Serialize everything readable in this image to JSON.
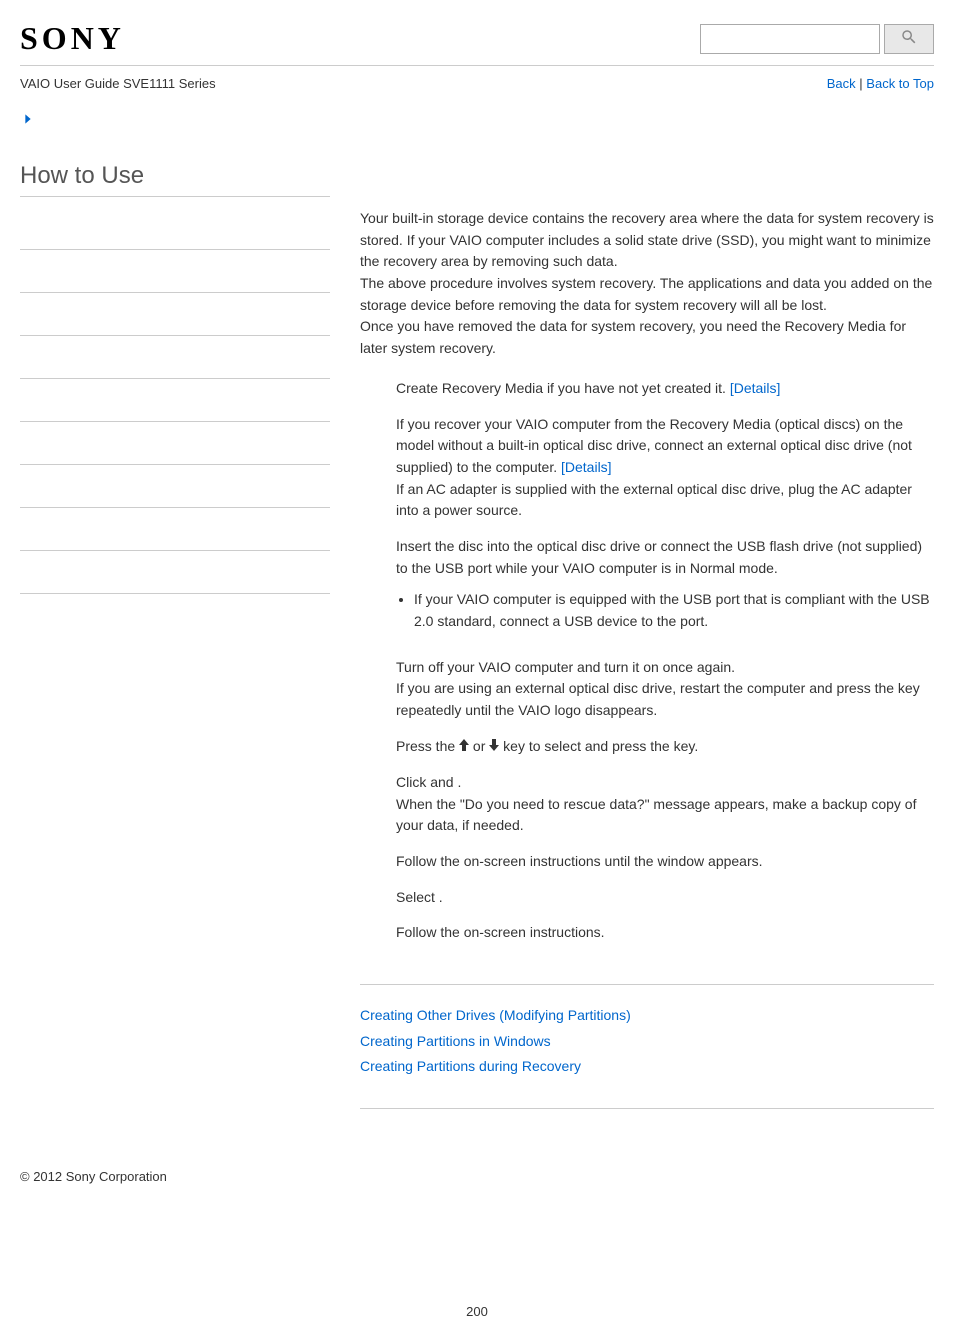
{
  "header": {
    "logo": "SONY",
    "guide_label": "VAIO User Guide SVE1111 Series",
    "back_label": "Back",
    "top_label": "Back to Top"
  },
  "sidebar": {
    "title": "How to Use"
  },
  "content": {
    "intro_p1": "Your built-in storage device contains the recovery area where the data for system recovery is stored. If your VAIO computer includes a solid state drive (SSD), you might want to minimize the recovery area by removing such data.",
    "intro_p2": "The above procedure involves system recovery. The applications and data you added on the storage device before removing the data for system recovery will all be lost.",
    "intro_p3": "Once you have removed the data for system recovery, you need the Recovery Media for later system recovery.",
    "step1_a": "Create Recovery Media if you have not yet created it. ",
    "details_label": "[Details]",
    "step2_a": "If you recover your VAIO computer from the Recovery Media (optical discs) on the model without a built-in optical disc drive, connect an external optical disc drive (not supplied) to the computer. ",
    "step2_b": "If an AC adapter is supplied with the external optical disc drive, plug the AC adapter into a power source.",
    "step3": "Insert the disc into the optical disc drive or connect the USB flash drive (not supplied) to the USB port while your VAIO computer is in Normal mode.",
    "note1": "If your VAIO computer is equipped with the USB port that is compliant with the USB 2.0 standard, connect a USB device to the port.",
    "step4_a": "Turn off your VAIO computer and turn it on once again.",
    "step4_b": "If you are using an external optical disc drive, restart the computer and press the         key repeatedly until the VAIO logo disappears.",
    "step5_a": "Press the ",
    "step5_b": " or ",
    "step5_c": " key to select                                          and press the               key.",
    "step6_a": "Click             and                                                                        .",
    "step6_b": "When the \"Do you need to rescue data?\" message appears, make a backup copy of your data, if needed.",
    "step7": "Follow the on-screen instructions until the                                                 window appears.",
    "step8": "Select                                                                                          .",
    "step9": "Follow the on-screen instructions.",
    "related": [
      "Creating Other Drives (Modifying Partitions)",
      "Creating Partitions in Windows",
      "Creating Partitions during Recovery"
    ]
  },
  "footer": {
    "copyright": "© 2012 Sony Corporation",
    "page_number": "200"
  }
}
